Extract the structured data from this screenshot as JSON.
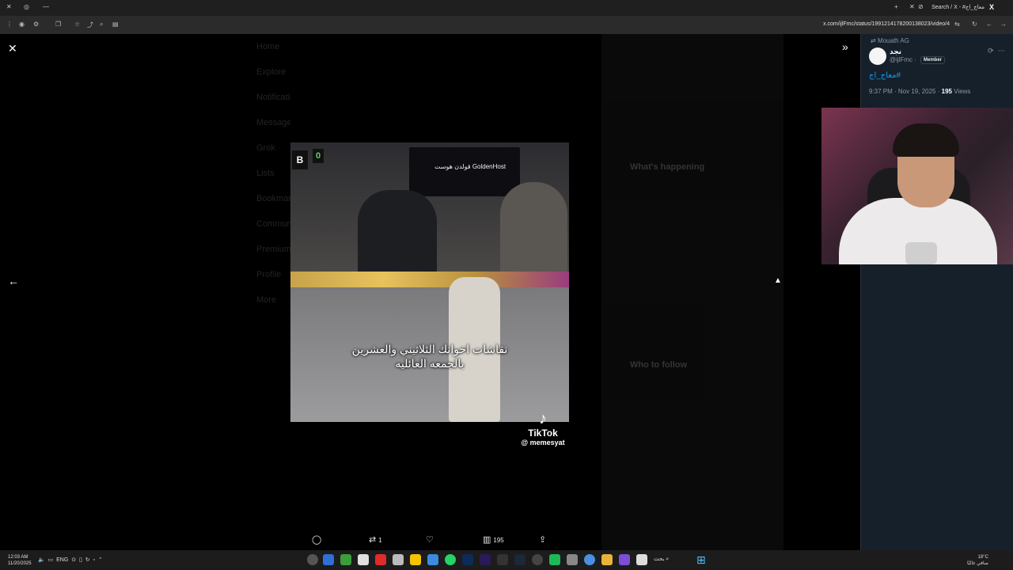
{
  "browser": {
    "tab_title": "Search / X - #معاج_اج",
    "url": "x.com/ijlFmc/status/1991214178200138023/video/4"
  },
  "viewer": {
    "caption_line1": "نقاشات اخوانك الثلاثيني والعشرين",
    "caption_line2": "بالجمعه العائليه",
    "score_left": "B",
    "score_right": "0",
    "banner_text": "قولدن هوست GoldenHost",
    "tiktok_brand": "TikTok",
    "tiktok_handle": "@ memesyat",
    "background_nav": [
      "Home",
      "Explore",
      "Notifications",
      "Messages",
      "Grok",
      "Lists",
      "Bookmarks",
      "Communities",
      "Premium",
      "Profile",
      "More"
    ],
    "background_right": {
      "whats_happening": "What's happening",
      "who_to_follow": "Who to follow"
    }
  },
  "actions": {
    "reply_count": "",
    "repost_count": "1",
    "like_count": "",
    "views_count": "195"
  },
  "tweet": {
    "repost_by": "Mouath AG",
    "name": "نجد",
    "handle": "@ijlFmc ·",
    "member_badge": "Member",
    "hashtag": "#معاج_اج",
    "time": "9:37 PM · Nov 19, 2025 ·",
    "views_num": "195",
    "views_label": "Views"
  },
  "taskbar": {
    "time": "12:03 AM",
    "date": "11/20/2025",
    "lang": "ENG",
    "search_label": "بحث",
    "weather_temp": "18°C",
    "weather_desc": "صافي غالبًا"
  },
  "colors": {
    "accent": "#1d9bf0",
    "panel_bg": "#15202b",
    "viewer_bg": "#000000"
  }
}
